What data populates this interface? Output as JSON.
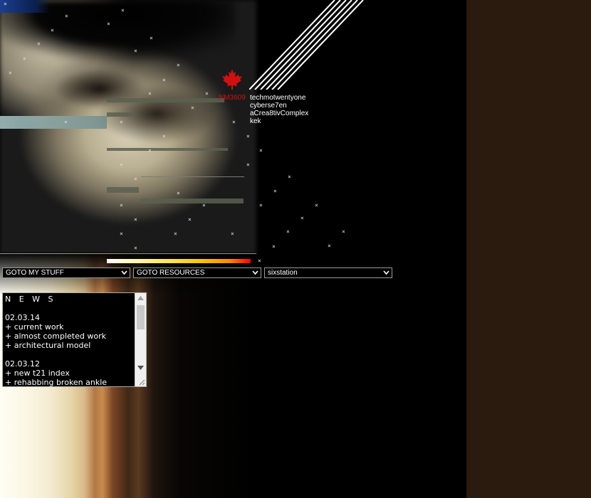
{
  "header": {
    "badge_icon": "maple-leaf-icon",
    "badge_color": "#d01010",
    "id_label": "NM3609",
    "site_names": [
      "techmotwentyone",
      "cyberse7en",
      "aCrea8tivComplex",
      "kek"
    ]
  },
  "nav": {
    "select_1": {
      "selected": "GOTO MY STUFF"
    },
    "select_2": {
      "selected": "GOTO RESOURCES"
    },
    "select_3": {
      "selected": "sixstation"
    }
  },
  "news": {
    "heading": "N E W S",
    "entries": [
      {
        "date": "02.03.14",
        "items": [
          "+ current work",
          "+ almost completed work",
          "+ architectural model"
        ]
      },
      {
        "date": "02.03.12",
        "items": [
          "+ new t21 index",
          "+ rehabbing broken ankle"
        ]
      }
    ]
  },
  "decor": {
    "sparkle_glyph": "×"
  }
}
